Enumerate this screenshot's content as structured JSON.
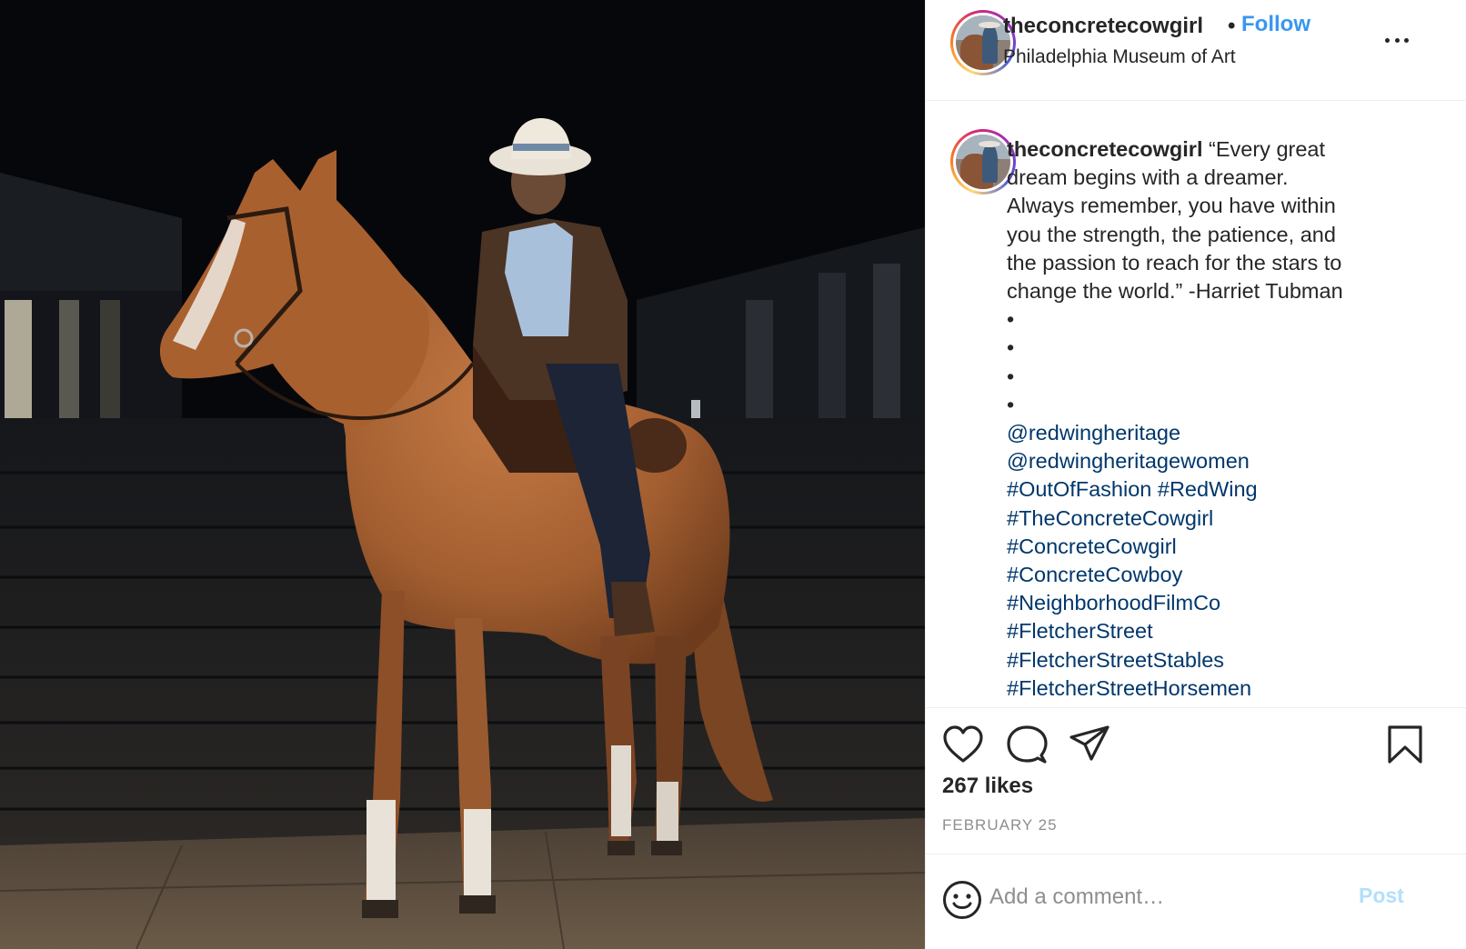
{
  "header": {
    "username": "theconcretecowgirl",
    "separator": "•",
    "follow_label": "Follow",
    "location": "Philadelphia Museum of Art",
    "more_icon": "more-horizontal-icon"
  },
  "caption": {
    "username": "theconcretecowgirl",
    "lines": [
      "“Every great",
      "dream begins with a dreamer.",
      "Always remember, you have within",
      "you the strength, the patience, and",
      "the passion to reach for the stars to",
      "change the world.” -Harriet Tubman",
      "•",
      "•",
      "•",
      "•"
    ],
    "tags": [
      "@redwingheritage",
      "@redwingheritagewomen",
      "#OutOfFashion #RedWing",
      "#TheConcreteCowgirl",
      "#ConcreteCowgirl",
      "#ConcreteCowboy",
      "#NeighborhoodFilmCo",
      "#FletcherStreet",
      "#FletcherStreetStables",
      "#FletcherStreetHorsemen"
    ]
  },
  "actions": {
    "like_icon": "heart-icon",
    "comment_icon": "comment-icon",
    "share_icon": "send-icon",
    "save_icon": "bookmark-icon",
    "likes": "267 likes",
    "date": "FEBRUARY 25"
  },
  "comment": {
    "emoji_icon": "smiley-icon",
    "placeholder": "Add a comment…",
    "post_label": "Post"
  },
  "colors": {
    "link_blue": "#3897f0",
    "hashtag": "#00376b",
    "muted": "#8e8e8e",
    "post_disabled": "#b2dffc"
  }
}
